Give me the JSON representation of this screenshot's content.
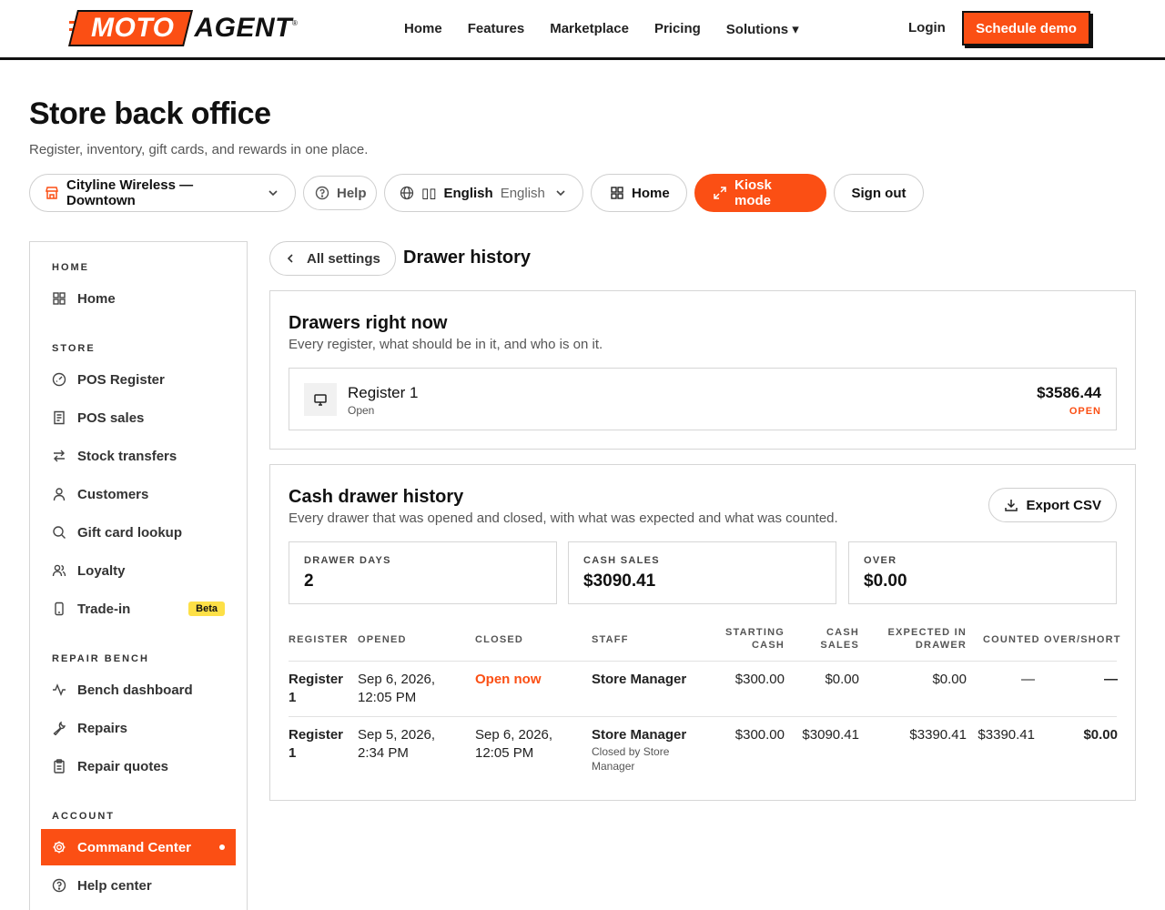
{
  "brand": {
    "logo_left": "MOTO",
    "logo_right": "AGENT",
    "trademark": "®",
    "accent": "#fb4f14"
  },
  "nav": {
    "links": [
      "Home",
      "Features",
      "Marketplace",
      "Pricing",
      "Solutions ▾"
    ],
    "login": "Login",
    "cta": "Schedule demo"
  },
  "header": {
    "title": "Store back office",
    "subtitle": "Register, inventory, gift cards, and rewards in one place."
  },
  "toolbar": {
    "store": "Cityline Wireless — Downtown",
    "help": "Help",
    "language_flag": "▯▯",
    "language": "English",
    "language_native": "English",
    "home": "Home",
    "kiosk": "Kiosk mode",
    "sign_out": "Sign out"
  },
  "sidebar": {
    "sections": [
      {
        "title": "HOME",
        "items": [
          {
            "label": "Home",
            "icon": "grid-icon"
          }
        ]
      },
      {
        "title": "STORE",
        "items": [
          {
            "label": "POS Register",
            "icon": "gauge-icon"
          },
          {
            "label": "POS sales",
            "icon": "receipt-icon"
          },
          {
            "label": "Stock transfers",
            "icon": "arrows-icon"
          },
          {
            "label": "Customers",
            "icon": "user-icon"
          },
          {
            "label": "Gift card lookup",
            "icon": "search-icon"
          },
          {
            "label": "Loyalty",
            "icon": "users-icon"
          },
          {
            "label": "Trade-in",
            "icon": "phone-icon",
            "badge": "Beta"
          }
        ]
      },
      {
        "title": "REPAIR BENCH",
        "items": [
          {
            "label": "Bench dashboard",
            "icon": "activity-icon"
          },
          {
            "label": "Repairs",
            "icon": "wrench-icon"
          },
          {
            "label": "Repair quotes",
            "icon": "clipboard-icon"
          }
        ]
      },
      {
        "title": "ACCOUNT",
        "items": [
          {
            "label": "Command Center",
            "icon": "gear-icon",
            "active": true
          },
          {
            "label": "Help center",
            "icon": "help-icon"
          }
        ]
      }
    ]
  },
  "main": {
    "back_label": "All settings",
    "title": "Drawer history",
    "now": {
      "title": "Drawers right now",
      "subtitle": "Every register, what should be in it, and who is on it.",
      "register": {
        "name": "Register 1",
        "status": "Open",
        "amount": "$3586.44",
        "badge": "OPEN"
      }
    },
    "history": {
      "title": "Cash drawer history",
      "subtitle": "Every drawer that was opened and closed, with what was expected and what was counted.",
      "export": "Export CSV",
      "stats": [
        {
          "label": "DRAWER DAYS",
          "value": "2"
        },
        {
          "label": "CASH SALES",
          "value": "$3090.41"
        },
        {
          "label": "OVER",
          "value": "$0.00"
        }
      ],
      "columns": [
        "REGISTER",
        "OPENED",
        "CLOSED",
        "STAFF",
        "STARTING CASH",
        "CASH SALES",
        "EXPECTED IN DRAWER",
        "COUNTED",
        "OVER/SHORT"
      ],
      "rows": [
        {
          "register": "Register 1",
          "opened": "Sep 6, 2026, 12:05 PM",
          "closed": "Open now",
          "staff": "Store Manager",
          "staff_note": "",
          "starting": "$300.00",
          "sales": "$0.00",
          "expected": "$0.00",
          "counted": "—",
          "over": "—"
        },
        {
          "register": "Register 1",
          "opened": "Sep 5, 2026, 2:34 PM",
          "closed": "Sep 6, 2026, 12:05 PM",
          "staff": "Store Manager",
          "staff_note": "Closed by Store Manager",
          "starting": "$300.00",
          "sales": "$3090.41",
          "expected": "$3390.41",
          "counted": "$3390.41",
          "over": "$0.00"
        }
      ]
    }
  }
}
